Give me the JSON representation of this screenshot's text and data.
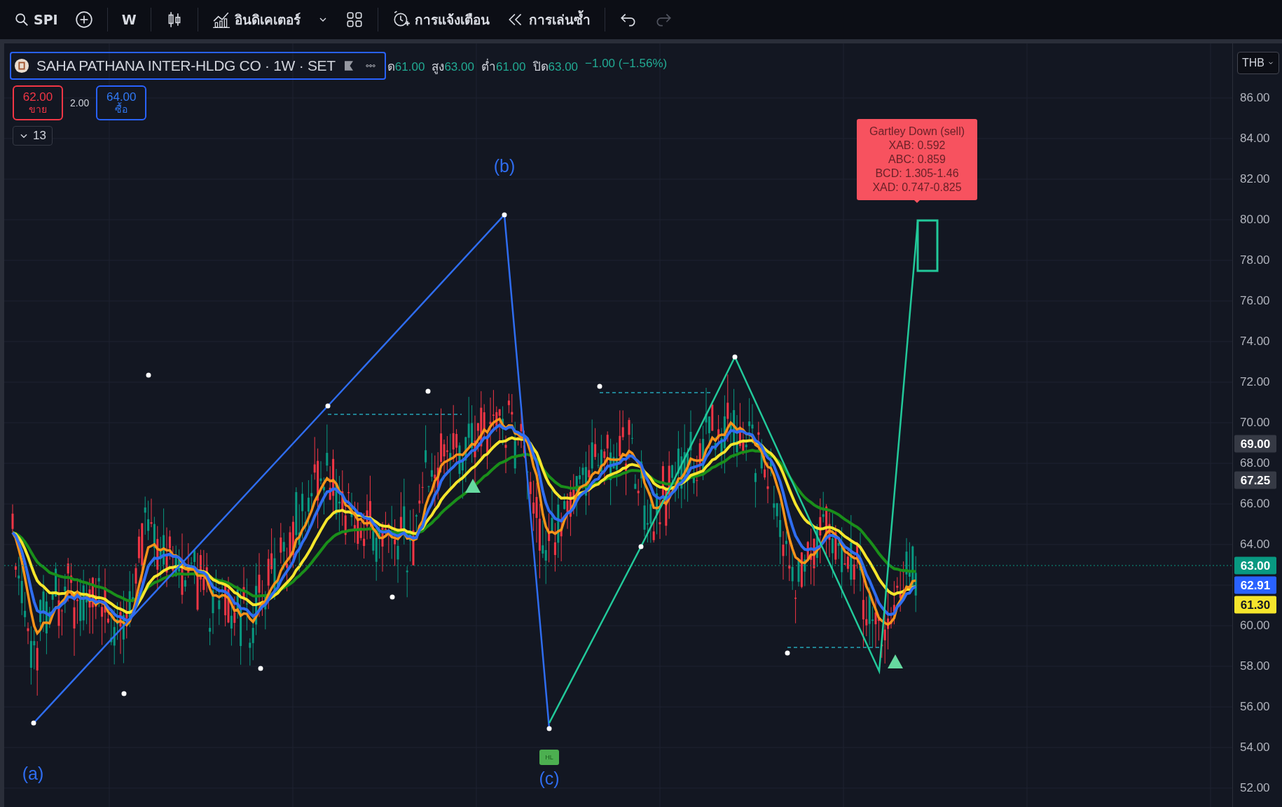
{
  "toolbar": {
    "items": [
      {
        "kind": "search",
        "label": "SPI"
      },
      {
        "kind": "add"
      },
      {
        "kind": "interval",
        "label": "W"
      },
      {
        "kind": "chart-type"
      },
      {
        "kind": "indicators",
        "label": "อินดิเคเตอร์"
      },
      {
        "kind": "templates"
      },
      {
        "kind": "alert",
        "label": "การแจ้งเตือน"
      },
      {
        "kind": "replay",
        "label": "การเล่นซ้ำ"
      },
      {
        "kind": "undo",
        "disabled": false
      },
      {
        "kind": "redo",
        "disabled": true
      }
    ]
  },
  "legend": {
    "title": "SAHA PATHANA INTER-HLDG CO · 1W · SET",
    "values": [
      {
        "label": "ด",
        "value": "61.00"
      },
      {
        "label": "สูง",
        "value": "63.00"
      },
      {
        "label": "ต่ำ",
        "value": "61.00"
      },
      {
        "label": "ปิด",
        "value": "63.00"
      }
    ],
    "change": "−1.00 (−1.56%)"
  },
  "trade": {
    "sell": {
      "price": "62.00",
      "label": "ขาย"
    },
    "spread": "2.00",
    "buy": {
      "price": "64.00",
      "label": "ซื้อ"
    }
  },
  "indicators_toggle": {
    "count": "13"
  },
  "currency": "THB",
  "price_axis": {
    "ticks": [
      "86.00",
      "84.00",
      "82.00",
      "80.00",
      "78.00",
      "76.00",
      "74.00",
      "72.00",
      "70.00",
      "68.00",
      "66.00",
      "64.00",
      "60.00",
      "58.00",
      "56.00",
      "54.00",
      "52.00"
    ],
    "badges": [
      {
        "text": "69.00",
        "color": "#363a45"
      },
      {
        "text": "67.25",
        "color": "#363a45"
      },
      {
        "text": "63.00",
        "color": "#089981"
      },
      {
        "text": "62.91",
        "color": "#2962ff"
      },
      {
        "text": "61.30",
        "color": "#f5e52c"
      }
    ]
  },
  "chart": {
    "wave_labels": [
      "(a)",
      "(b)",
      "(c)"
    ],
    "marker_label": "HL",
    "pattern_label": {
      "lines": [
        "Gartley  Down (sell)",
        "XAB: 0.592",
        "ABC: 0.859",
        "BCD: 1.305-1.46",
        "XAD: 0.747-0.825"
      ]
    }
  }
}
